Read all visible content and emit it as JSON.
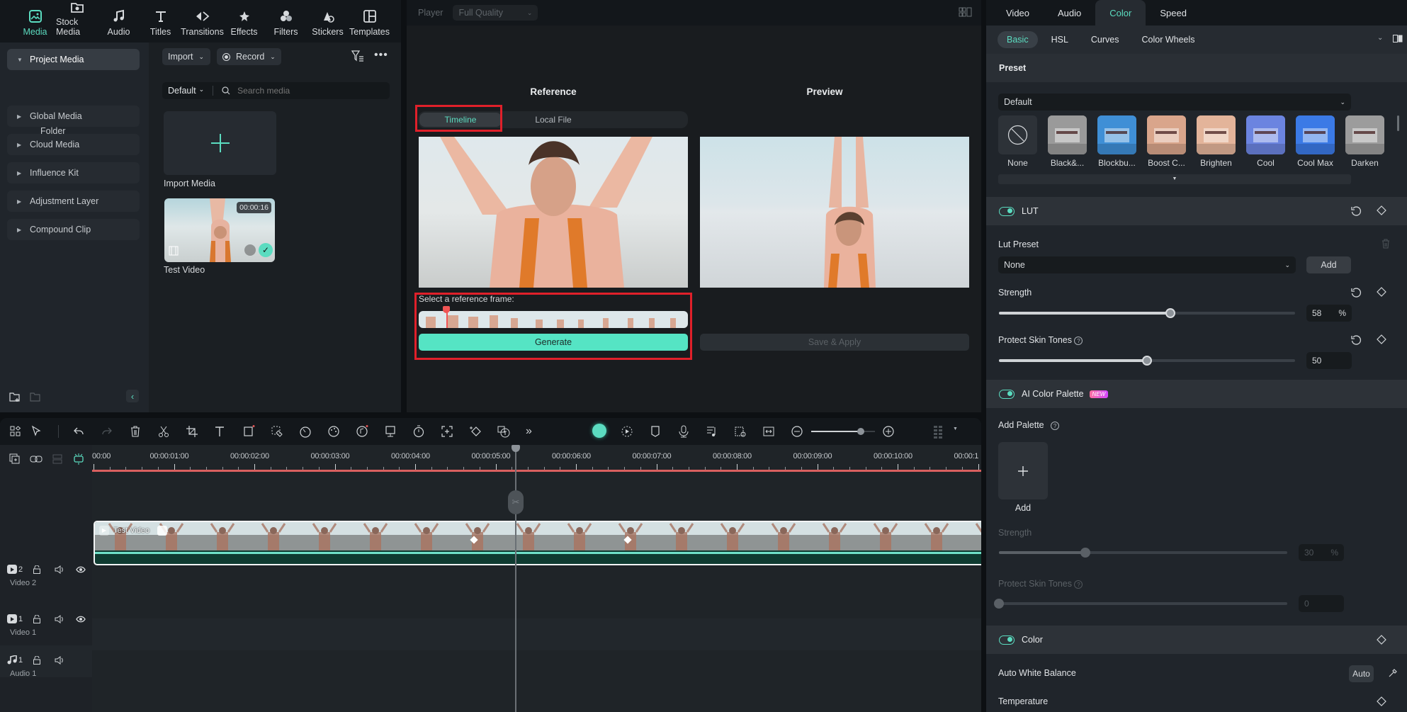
{
  "top_nav": {
    "items": [
      {
        "label": "Media",
        "icon": "media-icon",
        "active": true
      },
      {
        "label": "Stock Media",
        "icon": "stock-media-icon"
      },
      {
        "label": "Audio",
        "icon": "music-note-icon"
      },
      {
        "label": "Titles",
        "icon": "text-t-icon"
      },
      {
        "label": "Transitions",
        "icon": "transitions-icon"
      },
      {
        "label": "Effects",
        "icon": "effects-sparkle-icon"
      },
      {
        "label": "Filters",
        "icon": "filters-circles-icon"
      },
      {
        "label": "Stickers",
        "icon": "stickers-icon"
      },
      {
        "label": "Templates",
        "icon": "templates-grid-icon"
      }
    ]
  },
  "sidebar": {
    "items": [
      {
        "label": "Project Media",
        "expanded": true
      },
      {
        "label": "Global Media"
      },
      {
        "label": "Cloud Media"
      },
      {
        "label": "Influence Kit"
      },
      {
        "label": "Adjustment Layer"
      },
      {
        "label": "Compound Clip"
      }
    ],
    "folder_label": "Folder"
  },
  "media": {
    "import_label": "Import",
    "record_label": "Record",
    "sort_label": "Default",
    "search_placeholder": "Search media",
    "import_tile_label": "Import Media",
    "clips": [
      {
        "name": "Test Video",
        "duration": "00:00:16"
      }
    ]
  },
  "player": {
    "player_label": "Player",
    "quality": "Full Quality",
    "reference_title": "Reference",
    "preview_title": "Preview",
    "ref_tabs": [
      "Timeline",
      "Local File"
    ],
    "active_ref_tab": "Timeline",
    "select_frame_label": "Select a reference frame:",
    "generate_label": "Generate",
    "save_apply_label": "Save & Apply"
  },
  "props": {
    "tabs": [
      "Video",
      "Audio",
      "Color",
      "Speed"
    ],
    "active_tab": "Color",
    "subtabs": [
      "Basic",
      "HSL",
      "Curves",
      "Color Wheels"
    ],
    "active_subtab": "Basic",
    "preset_title": "Preset",
    "preset_dropdown": "Default",
    "presets": [
      "None",
      "Black&...",
      "Blockbu...",
      "Boost C...",
      "Brighten",
      "Cool",
      "Cool Max",
      "Darken"
    ],
    "lut": {
      "title": "LUT",
      "enabled": true,
      "preset_label": "Lut Preset",
      "preset_value": "None",
      "add_label": "Add",
      "strength_label": "Strength",
      "strength_value": "58",
      "strength_unit": "%",
      "protect_label": "Protect Skin Tones",
      "protect_value": "50"
    },
    "ai_palette": {
      "title": "AI Color Palette",
      "badge": "NEW",
      "enabled": true,
      "add_palette_label": "Add Palette",
      "add_label": "Add",
      "strength_label": "Strength",
      "strength_value": "30",
      "strength_unit": "%",
      "protect_label": "Protect Skin Tones",
      "protect_value": "0"
    },
    "color": {
      "title": "Color",
      "enabled": true,
      "awb_label": "Auto White Balance",
      "auto_label": "Auto",
      "temperature_label": "Temperature"
    }
  },
  "timeline": {
    "ruler": [
      "00:00",
      "00:00:01:00",
      "00:00:02:00",
      "00:00:03:00",
      "00:00:04:00",
      "00:00:05:00",
      "00:00:06:00",
      "00:00:07:00",
      "00:00:08:00",
      "00:00:09:00",
      "00:00:10:00",
      "00:00:1"
    ],
    "tracks": [
      {
        "num": "2",
        "name": "Video 2",
        "type": "video"
      },
      {
        "num": "1",
        "name": "Video 1",
        "type": "video"
      },
      {
        "num": "1",
        "name": "Audio 1",
        "type": "audio"
      }
    ],
    "clip_name": "Test Video",
    "playhead_time": "00:00:05:00",
    "zoom_level": 0.78
  },
  "colors": {
    "accent": "#5bdcc0",
    "highlight_red": "#e0202a",
    "ruler_red": "#d9605f"
  }
}
